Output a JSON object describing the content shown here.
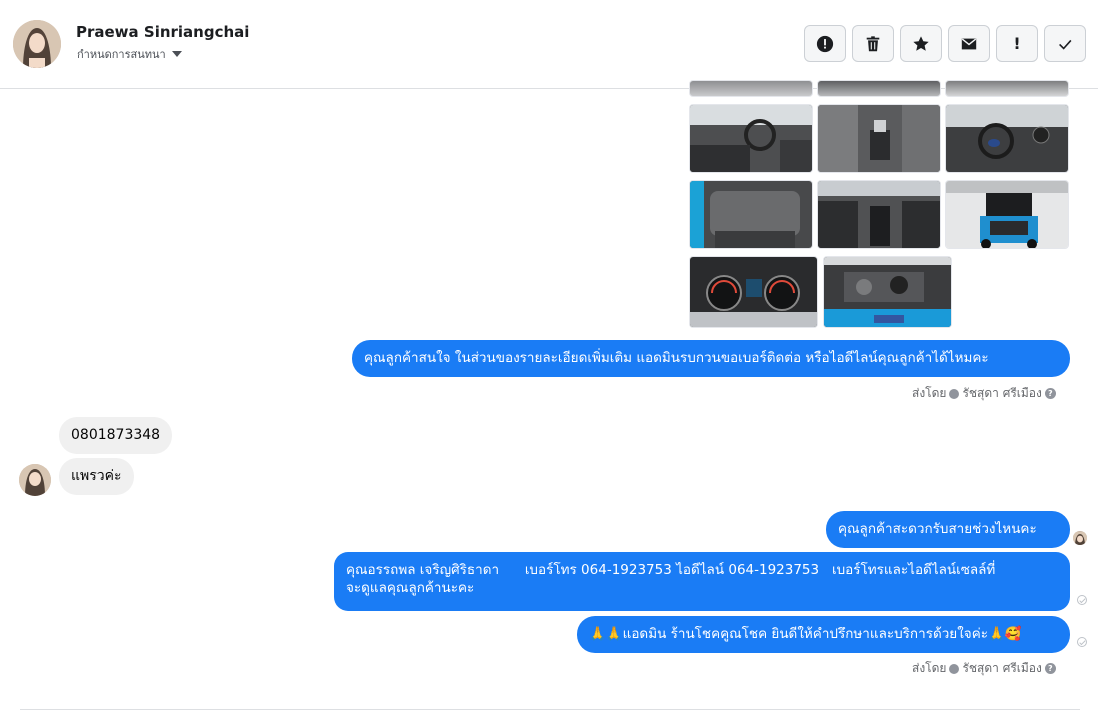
{
  "header": {
    "name": "Praewa Sinriangchai",
    "subtitle": "กำหนดการสนทนา",
    "avatar_icon": "profile-photo"
  },
  "toolbar": {
    "buttons": [
      {
        "name": "spam",
        "icon": "alert-circle-icon"
      },
      {
        "name": "delete",
        "icon": "trash-icon"
      },
      {
        "name": "star",
        "icon": "star-icon"
      },
      {
        "name": "unread",
        "icon": "envelope-icon"
      },
      {
        "name": "important",
        "label": "!"
      },
      {
        "name": "done",
        "icon": "checkmark-icon"
      }
    ]
  },
  "photos": {
    "count": 11,
    "descriptions": [
      "car-interior",
      "car-interior",
      "car-interior",
      "car-interior",
      "car-interior",
      "car-interior",
      "car-interior",
      "car-rear-trunk",
      "car-dashboard",
      "car-engine"
    ]
  },
  "messages": {
    "out_1": "คุณลูกค้าสนใจ ในส่วนของรายละเอียดเพิ่มเติม แอดมินรบกวนขอเบอร์ติดต่อ หรือไอดีไลน์คุณลูกค้าได้ไหมคะ",
    "sent_by_1_prefix": "ส่งโดย",
    "sent_by_1_name": "รัชสุดา ศรีเมือง",
    "in_1": "0801873348",
    "in_2": "แพรวค่ะ",
    "out_2": "คุณลูกค้าสะดวกรับสายช่วงไหนคะ",
    "out_3_line1": "คุณอรรถพล เจริญศิริธาดา      เบอร์โทร 064-1923753 ไอดีไลน์ 064-1923753   เบอร์โทรและไอดีไลน์เซลล์ที่",
    "out_3_line2": "จะดูแลคุณลูกค้านะคะ",
    "out_4": "🙏🙏แอดมิน ร้านโชคคูณโชค ยินดีให้คำปรึกษาและบริการด้วยใจค่ะ🙏🥰",
    "sent_by_2_prefix": "ส่งโดย",
    "sent_by_2_name": "รัชสุดา ศรีเมือง"
  },
  "colors": {
    "bubble_out": "#1a7cf5",
    "bubble_in": "#f0f0f0"
  }
}
